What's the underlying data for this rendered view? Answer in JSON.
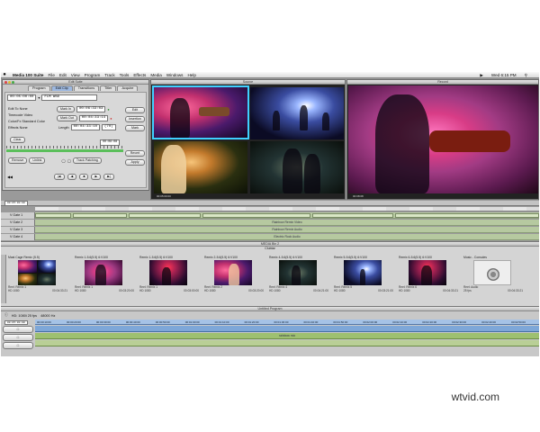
{
  "menubar": {
    "app": "Media 100 Suite",
    "items": [
      "File",
      "Edit",
      "View",
      "Program",
      "Track",
      "Tools",
      "Effects",
      "Media",
      "Windows",
      "Help"
    ],
    "clock": "Wed 6:15 PM"
  },
  "edit_suite": {
    "title": "Edit Suite",
    "tabs": [
      "Program",
      "Edit Clip",
      "Transitions",
      "Titler",
      "Acquire"
    ],
    "active_tab": "Edit Clip",
    "timecode": "00:05:00:00",
    "clip_name": "FLM WBD",
    "labels": [
      "Edit To None",
      "Timecode Video",
      "Color/Fx Standard Color",
      "Effects None"
    ],
    "mark_in_label": "Mark In",
    "mark_in_value": "00:06:33:03",
    "mark_out_label": "Mark Out",
    "mark_out_value": "00:04:33:14",
    "length_label": "Length",
    "length_value": "00:04:33:10",
    "rate": "(70)",
    "side_buttons": [
      "Edit",
      "Insertion",
      "Mark",
      "Revert",
      "Apply"
    ],
    "bottom_buttons": [
      "Remove",
      "Unlink",
      "Track Patching"
    ],
    "clear_label": "Clear",
    "counter": "00:08:08"
  },
  "source_viewer": {
    "title": "Source"
  },
  "record_viewer": {
    "title": "Record"
  },
  "timeline": {
    "tracks": [
      "V Gate 1",
      "V Gate 2",
      "V Gate 3",
      "V Gate 4"
    ],
    "lane_texts": [
      "",
      "Rainbow Remix Video",
      "Rainbow Remix Audio",
      "Electric Rock Audio"
    ]
  },
  "bin": {
    "title": "MEDIA Bin 2",
    "subtitle": "Clubtar",
    "items": [
      {
        "name": "Mast Cage Remix (5.5)",
        "sub": "Reel: Remix 1",
        "fmt": "HD 1080",
        "tc": "00:04:33:21"
      },
      {
        "name": "Remix 1-5.6(5.5) 6:V100",
        "sub": "Reel: Remix 1",
        "fmt": "HD 1080",
        "tc": "00:03:20:00"
      },
      {
        "name": "Remix 1-5.6(5.5) 6:V100",
        "sub": "Reel: Remix 1",
        "fmt": "HD 1080",
        "tc": "00:03:00:00"
      },
      {
        "name": "Remix 2-5.6(5.5) 6:V100",
        "sub": "Reel: Remix 2",
        "fmt": "HD 1080",
        "tc": "00:03:20:00"
      },
      {
        "name": "Remix 4-5.6(5.5) 6:V100",
        "sub": "Reel: Remix 4",
        "fmt": "HD 1080",
        "tc": "00:04:21:00"
      },
      {
        "name": "Remix 5-5.6(5.5) 6:V100",
        "sub": "Reel: Remix 5",
        "fmt": "HD 1080",
        "tc": "00:03:21:00"
      },
      {
        "name": "Remix 6-5.6(5.5) 6:V100",
        "sub": "Reel: Remix 6",
        "fmt": "HD 1080",
        "tc": "00:04:33:21"
      },
      {
        "name": "Music - Consoles",
        "sub": "Reel: Audio",
        "fmt": "25 fps",
        "tc": "00:04:33:21"
      }
    ]
  },
  "program": {
    "title": "Untitled Program",
    "format": "HD: 1080i 25 fps",
    "audio": "48000 Hz",
    "ruler": [
      "00:00:10:00",
      "00:00:20:00",
      "00:00:30:00",
      "00:00:40:00",
      "00:00:50:00",
      "00:01:00:00",
      "00:01:10:00",
      "00:01:20:00",
      "00:01:30:00",
      "00:01:40:00",
      "00:01:50:00",
      "00:02:00:00",
      "00:02:10:00",
      "00:02:20:00",
      "00:02:30:00",
      "00:02:40:00",
      "00:02:50:00"
    ],
    "lane_label": "rainbow mix"
  },
  "watermark": "wtvid.com"
}
